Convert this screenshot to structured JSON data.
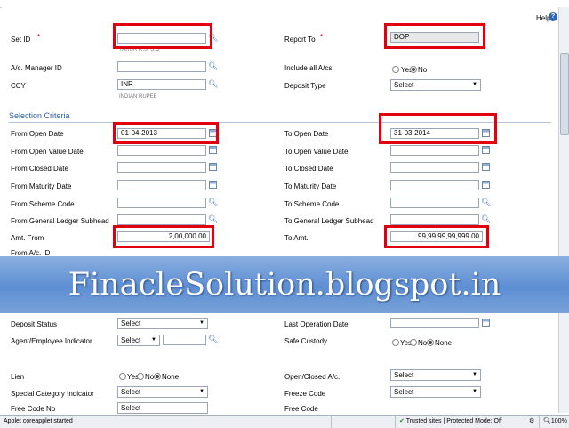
{
  "help": {
    "label": "Help"
  },
  "fields": {
    "set_id": {
      "label": "Set ID",
      "value": "",
      "sub": "TARUR R.S. S.O"
    },
    "report_to": {
      "label": "Report To",
      "value": "DOP"
    },
    "ac_manager_id": {
      "label": "A/c. Manager ID",
      "value": ""
    },
    "include_all_acs": {
      "label": "Include all A/cs",
      "options": [
        "Yes",
        "No"
      ],
      "selected": "No"
    },
    "ccy": {
      "label": "CCY",
      "value": "INR",
      "sub": "INDIAN RUPEE"
    },
    "deposit_type": {
      "label": "Deposit Type",
      "value": "Select"
    }
  },
  "criteria": {
    "title": "Selection Criteria",
    "from_open_date": {
      "label": "From Open Date",
      "value": "01-04-2013"
    },
    "to_open_date": {
      "label": "To Open Date",
      "value": "31-03-2014"
    },
    "from_open_value_date": {
      "label": "From Open Value Date",
      "value": ""
    },
    "to_open_value_date": {
      "label": "To Open Value Date",
      "value": ""
    },
    "from_closed_date": {
      "label": "From Closed Date",
      "value": ""
    },
    "to_closed_date": {
      "label": "To Closed Date",
      "value": ""
    },
    "from_maturity_date": {
      "label": "From Maturity Date",
      "value": ""
    },
    "to_maturity_date": {
      "label": "To Maturity Date",
      "value": ""
    },
    "from_scheme_code": {
      "label": "From Scheme Code",
      "value": ""
    },
    "to_scheme_code": {
      "label": "To Scheme Code",
      "value": ""
    },
    "from_gl_subhead": {
      "label": "From General Ledger Subhead",
      "value": ""
    },
    "to_gl_subhead": {
      "label": "To General Ledger Subhead",
      "value": ""
    },
    "amt_from": {
      "label": "Amt. From",
      "value": "2,00,000.00"
    },
    "to_amt": {
      "label": "To Amt.",
      "value": "99,99,99,99,999.00"
    },
    "from_ac_id": {
      "label": "From A/c. ID"
    }
  },
  "banner": {
    "text": "FinacleSolution.blogspot.in"
  },
  "lower": {
    "deposit_status": {
      "label": "Deposit Status",
      "value": "Select"
    },
    "last_operation_date": {
      "label": "Last Operation Date",
      "value": ""
    },
    "agent_indicator": {
      "label": "Agent/Employee Indicator",
      "value": "Select"
    },
    "safe_custody": {
      "label": "Safe Custody",
      "options": [
        "Yes",
        "No",
        "None"
      ],
      "selected": "None"
    },
    "lien": {
      "label": "Lien",
      "options": [
        "Yes",
        "No",
        "None"
      ],
      "selected": "None"
    },
    "open_closed_ac": {
      "label": "Open/Closed A/c.",
      "value": "Select"
    },
    "special_category": {
      "label": "Special Category Indicator",
      "value": "Select"
    },
    "freeze_code": {
      "label": "Freeze Code",
      "value": "Select"
    },
    "free_code_left": {
      "label": "Free Code No",
      "value": "Select"
    },
    "free_code_right": {
      "label": "Free Code"
    }
  },
  "statusbar": {
    "left": "Applet coreapplet started",
    "trusted": "Trusted sites | Protected Mode: Off",
    "zoom": "100%"
  },
  "colors": {
    "highlight": "#e00010",
    "section": "#2a5fa5",
    "banner": "#5d8fd4"
  }
}
